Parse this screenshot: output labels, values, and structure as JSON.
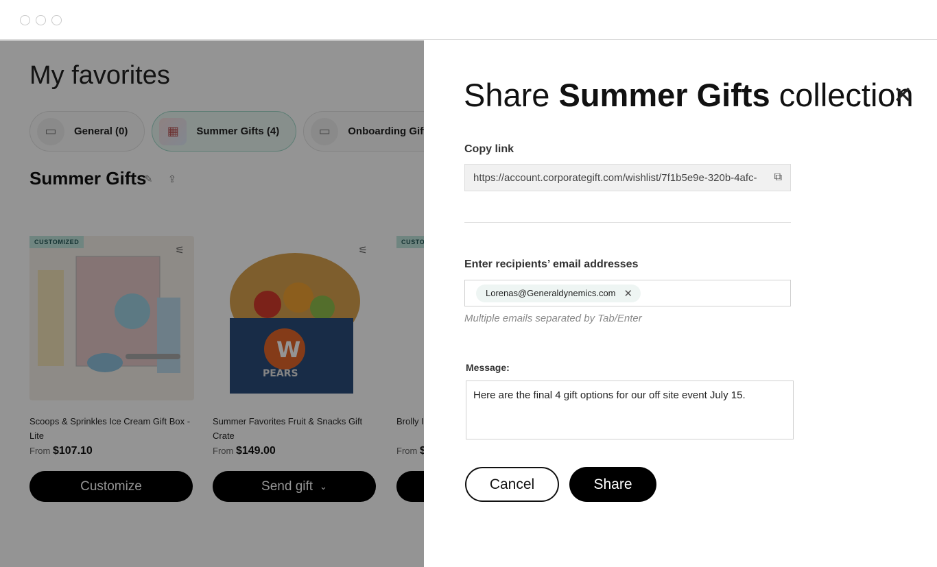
{
  "page": {
    "title": "My favorites",
    "tabs": [
      {
        "label": "General (0)"
      },
      {
        "label": "Summer Gifts (4)"
      },
      {
        "label": "Onboarding Gift Ideas"
      }
    ],
    "collection_title": "Summer Gifts",
    "products": [
      {
        "badge": "CUSTOMIZED",
        "name": "Scoops & Sprinkles Ice Cream Gift Box - Lite",
        "price_prefix": "From",
        "price": "$107.10",
        "button": "Customize"
      },
      {
        "badge": "",
        "name": "Summer Favorites Fruit & Snacks Gift Crate",
        "price_prefix": "From",
        "price": "$149.00",
        "button": "Send gift"
      },
      {
        "badge": "CUSTO",
        "name": "Brolly I",
        "price_prefix": "From",
        "price": "$",
        "button": ""
      }
    ]
  },
  "drawer": {
    "title_prefix": "Share",
    "title_bold": "Summer Gifts",
    "title_suffix": "collection",
    "copy_link_label": "Copy link",
    "copy_link_url": "https://account.corporategift.com/wishlist/7f1b5e9e-320b-4afc-",
    "recipients_label": "Enter recipients’ email addresses",
    "recipient_chip": "Lorenas@Generaldynemics.com",
    "recipients_hint": "Multiple emails separated by Tab/Enter",
    "message_label": "Message:",
    "message_value": "Here are the final 4 gift options for our off site event July 15.",
    "cancel_label": "Cancel",
    "share_label": "Share"
  },
  "icons": {
    "close": "close-icon",
    "copy": "copy-icon",
    "edit": "pencil-icon",
    "share": "share-icon",
    "filter": "sliders-icon",
    "chevron": "chevron-down-icon",
    "chip_remove": "close-icon"
  },
  "colors": {
    "overlay": "#000000",
    "accent_badge": "#bfe6dc",
    "active_tab": "#e9f6f2",
    "button_dark": "#000000"
  }
}
